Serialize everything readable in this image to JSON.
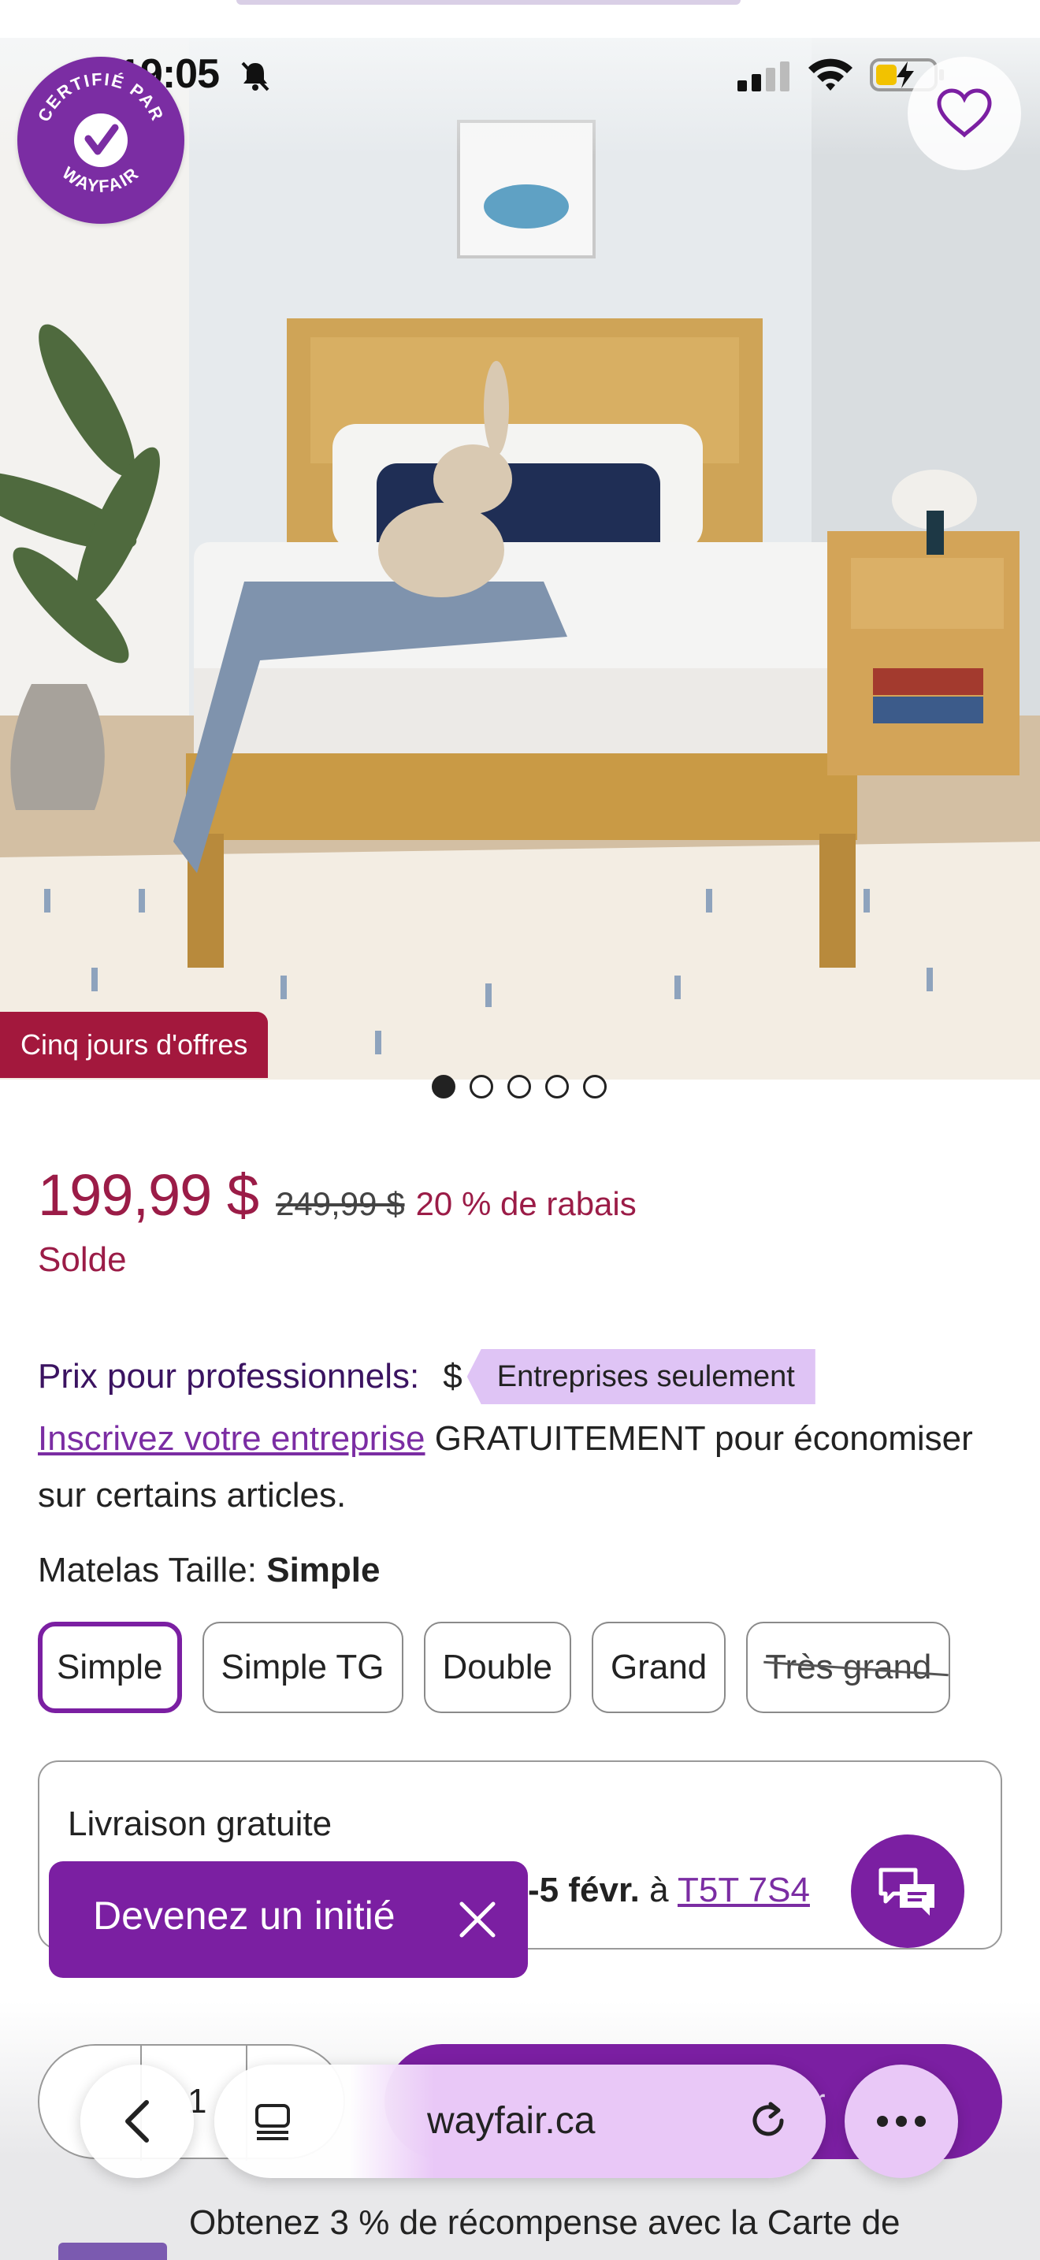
{
  "status_bar": {
    "time": "19:05"
  },
  "badge": {
    "line1": "CERTIFIÉ PAR",
    "line2": "WAYFAIR"
  },
  "hero": {
    "promo_tag": "Cinq jours d'offres",
    "image_count": 5,
    "active_image": 1
  },
  "pricing": {
    "price": "199,99 $",
    "old_price": "249,99 $",
    "discount": "20 % de rabais",
    "sale_label": "Solde"
  },
  "pro": {
    "label": "Prix pour professionnels:",
    "dollar": "$",
    "tag": "Entreprises seulement",
    "link": "Inscrivez votre entreprise",
    "text": " GRATUITEMENT pour économiser sur certains articles."
  },
  "size": {
    "label": "Matelas Taille: ",
    "selected": "Simple",
    "options": [
      "Simple",
      "Simple TG",
      "Double",
      "Grand",
      "Très grand"
    ]
  },
  "delivery": {
    "title": "Livraison gratuite",
    "date_bold": "-5 févr.",
    "date_mid": " à ",
    "zip": "T5T 7S4"
  },
  "insider": {
    "label": "Devenez un initié"
  },
  "quantity": {
    "value": "1"
  },
  "cart": {
    "label": "Ajouter au panier"
  },
  "browser": {
    "host": "wayfair.ca"
  },
  "reward": {
    "text": "Obtenez 3 % de récompense avec la Carte de"
  },
  "colors": {
    "brand_purple": "#7b1fa2",
    "sale_red": "#9b1c47",
    "tag_purple": "#dfc4f5"
  }
}
